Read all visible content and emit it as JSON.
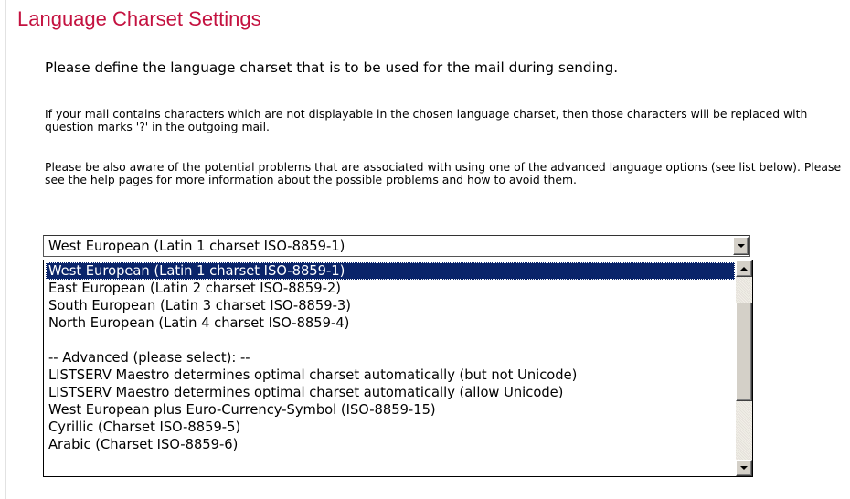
{
  "page": {
    "title": "Language Charset Settings",
    "intro": "Please define the language charset that is to be used for the mail during sending.",
    "warning": "If your mail contains characters which are not displayable in the chosen language charset, then those characters will be replaced with question marks '?' in the outgoing mail.",
    "advisory": "Please be also aware of the potential problems that are associated with using one of the advanced language options (see list below). Please see the help pages for more information about the possible problems and how to avoid them."
  },
  "charset_select": {
    "selected_value": "West European (Latin 1 charset ISO-8859-1)",
    "options": [
      {
        "label": "West European (Latin 1 charset ISO-8859-1)",
        "selected": true
      },
      {
        "label": "East European (Latin 2 charset ISO-8859-2)",
        "selected": false
      },
      {
        "label": "South European (Latin 3 charset ISO-8859-3)",
        "selected": false
      },
      {
        "label": "North European (Latin 4 charset ISO-8859-4)",
        "selected": false
      },
      {
        "label": "",
        "selected": false
      },
      {
        "label": "-- Advanced (please select): --",
        "selected": false
      },
      {
        "label": "LISTSERV Maestro determines optimal charset automatically (but not Unicode)",
        "selected": false
      },
      {
        "label": "LISTSERV Maestro determines optimal charset automatically (allow Unicode)",
        "selected": false
      },
      {
        "label": "West European plus Euro-Currency-Symbol (ISO-8859-15)",
        "selected": false
      },
      {
        "label": "Cyrillic (Charset ISO-8859-5)",
        "selected": false
      },
      {
        "label": "Arabic (Charset ISO-8859-6)",
        "selected": false
      }
    ]
  },
  "colors": {
    "title": "#c41240",
    "selection_bg": "#0a246a",
    "selection_fg": "#ffffff",
    "button_face": "#d4d0c8"
  },
  "icons": {
    "combo_button": "chevron-down-icon",
    "scroll_up": "arrow-up-icon",
    "scroll_down": "arrow-down-icon"
  }
}
